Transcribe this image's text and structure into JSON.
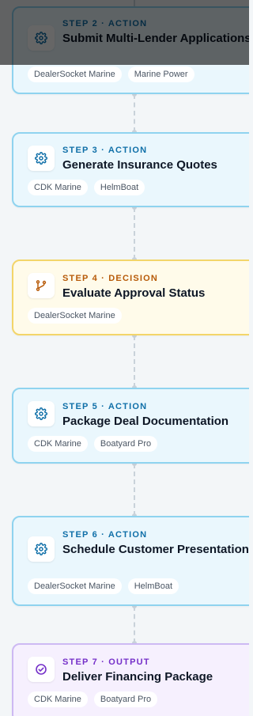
{
  "steps": [
    {
      "kind": "action",
      "label": "STEP 2 · ACTION",
      "title": "Submit Multi-Lender Applications",
      "icon": "gear-icon",
      "tags": [
        "DealerSocket Marine",
        "Marine Power"
      ]
    },
    {
      "kind": "action",
      "label": "STEP 3 · ACTION",
      "title": "Generate Insurance Quotes",
      "icon": "gear-icon",
      "tags": [
        "CDK Marine",
        "HelmBoat"
      ]
    },
    {
      "kind": "decision",
      "label": "STEP 4 · DECISION",
      "title": "Evaluate Approval Status",
      "icon": "branch-icon",
      "tags": [
        "DealerSocket Marine"
      ]
    },
    {
      "kind": "action",
      "label": "STEP 5 · ACTION",
      "title": "Package Deal Documentation",
      "icon": "gear-icon",
      "tags": [
        "CDK Marine",
        "Boatyard Pro"
      ]
    },
    {
      "kind": "action",
      "label": "STEP 6 · ACTION",
      "title": "Schedule Customer Presentation",
      "icon": "gear-icon",
      "tags": [
        "DealerSocket Marine",
        "HelmBoat"
      ]
    },
    {
      "kind": "output",
      "label": "STEP 7 · OUTPUT",
      "title": "Deliver Financing Package",
      "icon": "check-circle-icon",
      "tags": [
        "CDK Marine",
        "Boatyard Pro"
      ]
    }
  ],
  "colors": {
    "action_border": "#8fd3ef",
    "action_bg": "#eaf7fd",
    "action_accent": "#0f6fa8",
    "decision_border": "#f3d56a",
    "decision_bg": "#fffbea",
    "decision_accent": "#b75a08",
    "output_border": "#cdb9f3",
    "output_bg": "#f6f0fe",
    "output_accent": "#7530c9"
  }
}
